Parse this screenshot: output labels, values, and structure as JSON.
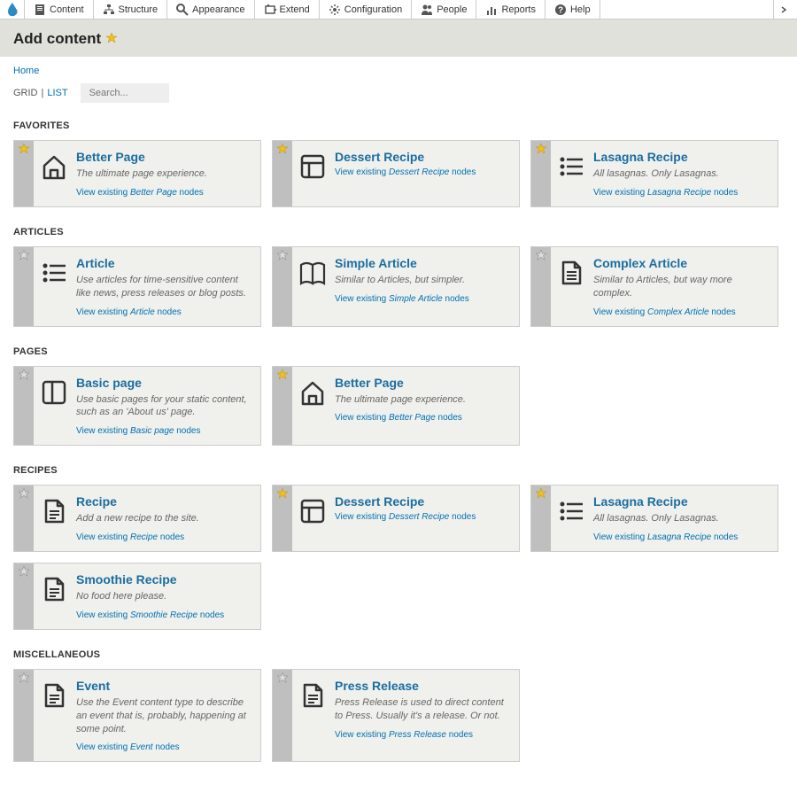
{
  "admin_bar": {
    "items": [
      {
        "label": "Content"
      },
      {
        "label": "Structure"
      },
      {
        "label": "Appearance"
      },
      {
        "label": "Extend"
      },
      {
        "label": "Configuration"
      },
      {
        "label": "People"
      },
      {
        "label": "Reports"
      },
      {
        "label": "Help"
      }
    ]
  },
  "page_title": "Add content",
  "breadcrumb": {
    "home": "Home"
  },
  "view_toggle": {
    "grid": "GRID",
    "list": "LIST",
    "sep": "|"
  },
  "search": {
    "placeholder": "Search..."
  },
  "sections": [
    {
      "title": "FAVORITES",
      "cards": [
        {
          "icon": "home",
          "favorite": true,
          "title": "Better Page",
          "desc": "The ultimate page experience.",
          "link_prefix": "View existing ",
          "link_em": "Better Page",
          "link_suffix": " nodes"
        },
        {
          "icon": "layout",
          "favorite": true,
          "title": "Dessert Recipe",
          "desc": "",
          "link_prefix": "View existing ",
          "link_em": "Dessert Recipe",
          "link_suffix": " nodes"
        },
        {
          "icon": "list",
          "favorite": true,
          "title": "Lasagna Recipe",
          "desc": "All lasagnas. Only Lasagnas.",
          "link_prefix": "View existing ",
          "link_em": "Lasagna Recipe",
          "link_suffix": " nodes"
        }
      ]
    },
    {
      "title": "ARTICLES",
      "cards": [
        {
          "icon": "list",
          "favorite": false,
          "title": "Article",
          "desc": "Use articles for time-sensitive content like news, press releases or blog posts.",
          "link_prefix": "View existing ",
          "link_em": "Article",
          "link_suffix": " nodes"
        },
        {
          "icon": "book",
          "favorite": false,
          "title": "Simple Article",
          "desc": "Similar to Articles, but simpler.",
          "link_prefix": "View existing ",
          "link_em": "Simple Article",
          "link_suffix": " nodes"
        },
        {
          "icon": "doc2",
          "favorite": false,
          "title": "Complex Article",
          "desc": "Similar to Articles, but way more complex.",
          "link_prefix": "View existing ",
          "link_em": "Complex Article",
          "link_suffix": " nodes"
        }
      ]
    },
    {
      "title": "PAGES",
      "cards": [
        {
          "icon": "panel",
          "favorite": false,
          "title": "Basic page",
          "desc": "Use basic pages for your static content, such as an 'About us' page.",
          "link_prefix": "View existing ",
          "link_em": "Basic page",
          "link_suffix": " nodes"
        },
        {
          "icon": "home",
          "favorite": true,
          "title": "Better Page",
          "desc": "The ultimate page experience.",
          "link_prefix": "View existing ",
          "link_em": "Better Page",
          "link_suffix": " nodes"
        }
      ]
    },
    {
      "title": "RECIPES",
      "cards": [
        {
          "icon": "doc",
          "favorite": false,
          "title": "Recipe",
          "desc": "Add a new recipe to the site.",
          "link_prefix": "View existing ",
          "link_em": "Recipe",
          "link_suffix": " nodes"
        },
        {
          "icon": "layout",
          "favorite": true,
          "title": "Dessert Recipe",
          "desc": "",
          "link_prefix": "View existing ",
          "link_em": "Dessert Recipe",
          "link_suffix": " nodes"
        },
        {
          "icon": "list",
          "favorite": true,
          "title": "Lasagna Recipe",
          "desc": "All lasagnas. Only Lasagnas.",
          "link_prefix": "View existing ",
          "link_em": "Lasagna Recipe",
          "link_suffix": " nodes"
        },
        {
          "icon": "doc",
          "favorite": false,
          "title": "Smoothie Recipe",
          "desc": "No food here please.",
          "link_prefix": "View existing ",
          "link_em": "Smoothie Recipe",
          "link_suffix": " nodes"
        }
      ]
    },
    {
      "title": "MISCELLANEOUS",
      "cards": [
        {
          "icon": "doc",
          "favorite": false,
          "title": "Event",
          "desc": "Use the Event content type to describe an event that is, probably, happening at some point.",
          "link_prefix": "View existing ",
          "link_em": "Event",
          "link_suffix": " nodes"
        },
        {
          "icon": "doc",
          "favorite": false,
          "title": "Press Release",
          "desc": "Press Release is used to direct content to Press. Usually it's a release. Or not.",
          "link_prefix": "View existing ",
          "link_em": "Press Release",
          "link_suffix": " nodes"
        }
      ]
    }
  ]
}
